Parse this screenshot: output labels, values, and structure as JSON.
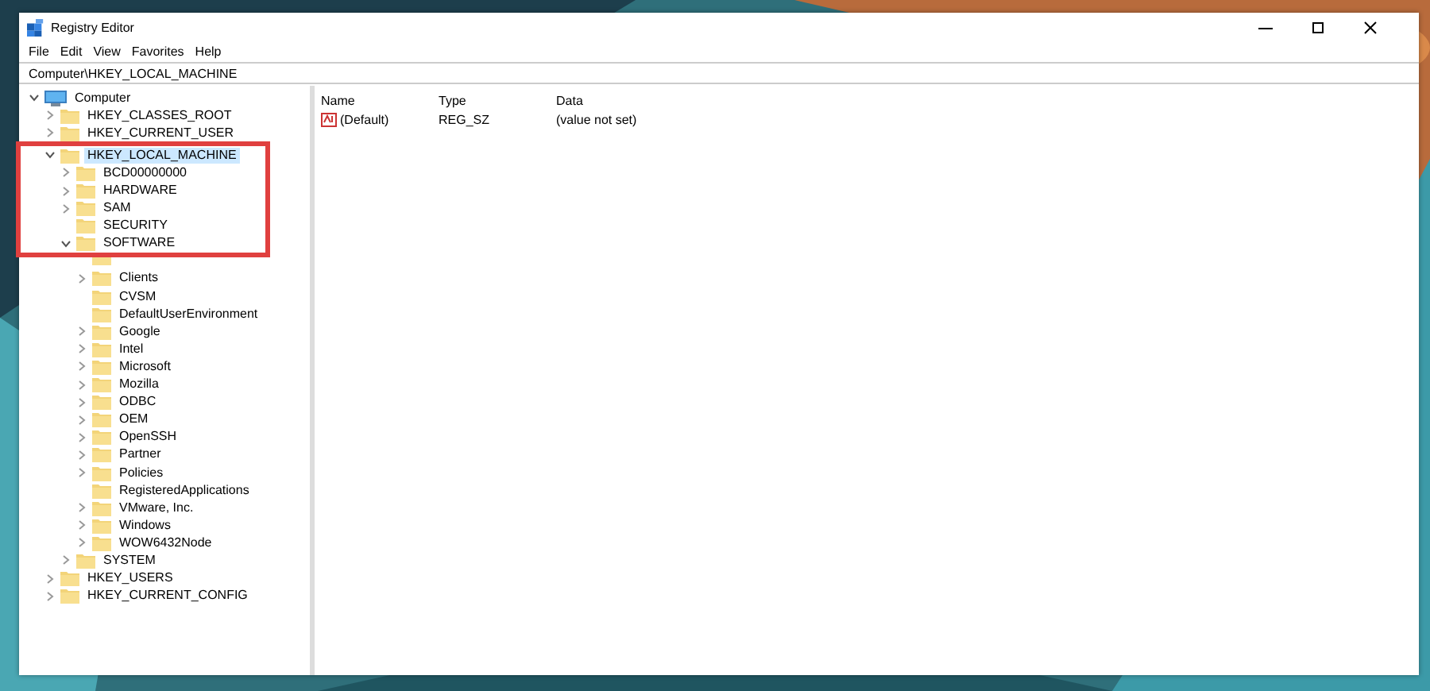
{
  "window": {
    "title": "Registry Editor"
  },
  "menu": [
    "File",
    "Edit",
    "View",
    "Favorites",
    "Help"
  ],
  "address": "Computer\\HKEY_LOCAL_MACHINE",
  "tree": [
    {
      "label": "Computer",
      "kind": "computer",
      "expanded": true,
      "selected": false,
      "children": [
        {
          "label": "HKEY_CLASSES_ROOT",
          "expanded": false,
          "selected": false
        },
        {
          "label": "HKEY_CURRENT_USER",
          "expanded": false,
          "selected": false
        },
        {
          "label": "HKEY_LOCAL_MACHINE",
          "expanded": true,
          "selected": true,
          "highlighted": true,
          "children": [
            {
              "label": "BCD00000000",
              "expanded": false,
              "selected": false
            },
            {
              "label": "HARDWARE",
              "expanded": false,
              "selected": false
            },
            {
              "label": "SAM",
              "expanded": false,
              "selected": false
            },
            {
              "label": "SECURITY",
              "selected": false
            },
            {
              "label": "SOFTWARE",
              "expanded": true,
              "selected": false,
              "children": [
                {
                  "kind": "covered"
                },
                {
                  "label": "Clients",
                  "expanded": false,
                  "selected": false
                },
                {
                  "label": "CVSM",
                  "selected": false
                },
                {
                  "label": "DefaultUserEnvironment",
                  "selected": false
                },
                {
                  "label": "Google",
                  "expanded": false,
                  "selected": false
                },
                {
                  "label": "Intel",
                  "expanded": false,
                  "selected": false
                },
                {
                  "label": "Microsoft",
                  "expanded": false,
                  "selected": false
                },
                {
                  "label": "Mozilla",
                  "expanded": false,
                  "selected": false
                },
                {
                  "label": "ODBC",
                  "expanded": false,
                  "selected": false
                },
                {
                  "label": "OEM",
                  "expanded": false,
                  "selected": false
                },
                {
                  "label": "OpenSSH",
                  "expanded": false,
                  "selected": false
                },
                {
                  "label": "Partner",
                  "expanded": false,
                  "selected": false
                },
                {
                  "label": "Policies",
                  "expanded": false,
                  "selected": false
                },
                {
                  "label": "RegisteredApplications",
                  "selected": false
                },
                {
                  "label": "VMware, Inc.",
                  "expanded": false,
                  "selected": false
                },
                {
                  "label": "Windows",
                  "expanded": false,
                  "selected": false
                },
                {
                  "label": "WOW6432Node",
                  "expanded": false,
                  "selected": false
                }
              ]
            },
            {
              "label": "SYSTEM",
              "expanded": false,
              "selected": false
            }
          ]
        },
        {
          "label": "HKEY_USERS",
          "expanded": false,
          "selected": false
        },
        {
          "label": "HKEY_CURRENT_CONFIG",
          "expanded": false,
          "selected": false
        }
      ]
    }
  ],
  "values": {
    "columns": [
      "Name",
      "Type",
      "Data"
    ],
    "rows": [
      {
        "name": "(Default)",
        "type": "REG_SZ",
        "data": "(value not set)"
      }
    ]
  }
}
